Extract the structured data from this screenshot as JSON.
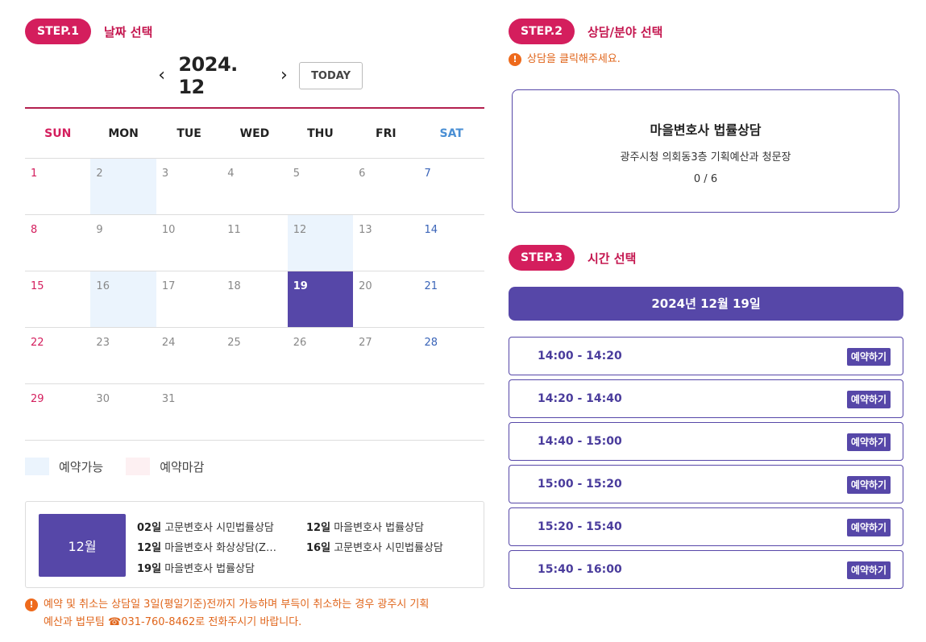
{
  "step1": {
    "badge": "STEP.1",
    "title": "날짜 선택"
  },
  "step2": {
    "badge": "STEP.2",
    "title": "상담/분야 선택",
    "notice": "상담을 클릭해주세요."
  },
  "step3": {
    "badge": "STEP.3",
    "title": "시간 선택"
  },
  "calendar": {
    "prev_icon": "‹",
    "next_icon": "›",
    "month_label": "2024. 12",
    "today_label": "TODAY",
    "weekdays": [
      "SUN",
      "MON",
      "TUE",
      "WED",
      "THU",
      "FRI",
      "SAT"
    ],
    "weeks": [
      [
        {
          "d": "1"
        },
        {
          "d": "2",
          "state": "available"
        },
        {
          "d": "3"
        },
        {
          "d": "4"
        },
        {
          "d": "5"
        },
        {
          "d": "6"
        },
        {
          "d": "7"
        }
      ],
      [
        {
          "d": "8"
        },
        {
          "d": "9"
        },
        {
          "d": "10"
        },
        {
          "d": "11"
        },
        {
          "d": "12",
          "state": "available"
        },
        {
          "d": "13"
        },
        {
          "d": "14"
        }
      ],
      [
        {
          "d": "15"
        },
        {
          "d": "16",
          "state": "available"
        },
        {
          "d": "17"
        },
        {
          "d": "18"
        },
        {
          "d": "19",
          "state": "selected"
        },
        {
          "d": "20"
        },
        {
          "d": "21"
        }
      ],
      [
        {
          "d": "22"
        },
        {
          "d": "23"
        },
        {
          "d": "24"
        },
        {
          "d": "25"
        },
        {
          "d": "26"
        },
        {
          "d": "27"
        },
        {
          "d": "28"
        }
      ],
      [
        {
          "d": "29"
        },
        {
          "d": "30"
        },
        {
          "d": "31"
        },
        {
          "d": ""
        },
        {
          "d": ""
        },
        {
          "d": ""
        },
        {
          "d": ""
        }
      ]
    ],
    "colors": {
      "available": "#ebf4fd",
      "closed": "#fdf0f2",
      "selected": "#5647a8"
    }
  },
  "legend": {
    "available": "예약가능",
    "closed": "예약마감"
  },
  "schedule": {
    "month": "12월",
    "items": [
      {
        "day": "02일",
        "text": "고문변호사 시민법률상담"
      },
      {
        "day": "12일",
        "text": "마을변호사 법률상담"
      },
      {
        "day": "12일",
        "text": "마을변호사 화상상담(Z…"
      },
      {
        "day": "16일",
        "text": "고문변호사 시민법률상담"
      },
      {
        "day": "19일",
        "text": "마을변호사 법률상담"
      }
    ]
  },
  "bottom_notice": {
    "line1": "예약 및 취소는 상담일 3일(평일기준)전까지 가능하며 부득이 취소하는 경우 광주시 기획",
    "line2": "예산과 법무팀 ☎031-760-8462로 전화주시기 바랍니다."
  },
  "counsel": {
    "title": "마을변호사 법률상담",
    "place": "광주시청 의회동3층 기획예산과 청문장",
    "count": "0 / 6"
  },
  "selected_date": "2024년 12월 19일",
  "slots": [
    {
      "time": "14:00 - 14:20",
      "button": "예약하기"
    },
    {
      "time": "14:20 - 14:40",
      "button": "예약하기"
    },
    {
      "time": "14:40 - 15:00",
      "button": "예약하기"
    },
    {
      "time": "15:00 - 15:20",
      "button": "예약하기"
    },
    {
      "time": "15:20 - 15:40",
      "button": "예약하기"
    },
    {
      "time": "15:40 - 16:00",
      "button": "예약하기"
    }
  ],
  "icons": {
    "warning": "exclamation-circle-icon",
    "prev": "chevron-left-icon",
    "next": "chevron-right-icon"
  },
  "accent": "#5647a8",
  "brand": "#d41e5d"
}
